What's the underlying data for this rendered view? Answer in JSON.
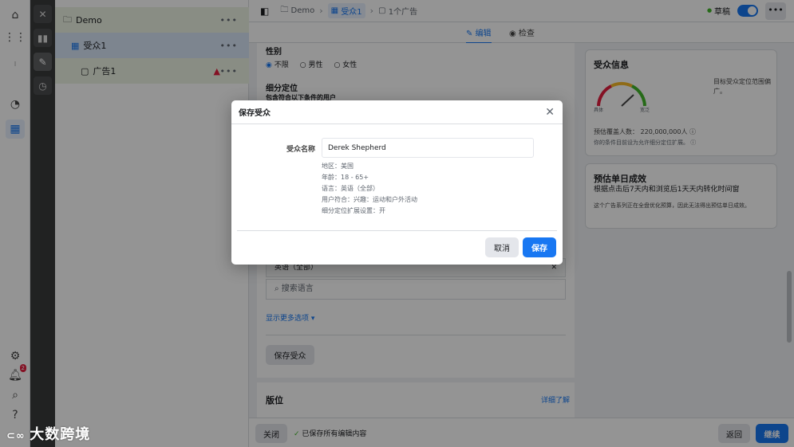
{
  "tree": {
    "campaign": "Demo",
    "adset": "受众1",
    "ad": "广告1"
  },
  "topbar": {
    "crumbs": [
      "Demo",
      "受众1",
      "1个广告"
    ],
    "draft_label": "草稿"
  },
  "tabs": {
    "edit": "编辑",
    "review": "检查"
  },
  "form": {
    "gender_label": "性别",
    "gender_options": [
      "不限",
      "男性",
      "女性"
    ],
    "detailed_targeting_label": "细分定位",
    "detailed_targeting_hint": "包含符合以下条件的用户",
    "language_value": "英语（全部）",
    "language_search_placeholder": "搜索语言",
    "show_more": "显示更多选项",
    "save_audience": "保存受众",
    "placements_label": "版位",
    "learn_more": "详细了解"
  },
  "audience_info": {
    "title": "受众信息",
    "gauge_left": "具体",
    "gauge_right": "宽泛",
    "gauge_desc": "目标受众定位范围偏广。",
    "estimated_reach_label": "预估覆盖人数：",
    "estimated_reach_value": "220,000,000人",
    "expansion_note": "你的条件目前设为允许细分定位扩展。"
  },
  "daily_results": {
    "title": "预估单日成效",
    "subtitle": "根据点击后7天内和浏览后1天天内转化时间窗",
    "note": "这个广告系列正在全盘优化预算，因此无法得出预估单日成效。"
  },
  "bottom_bar": {
    "close": "关闭",
    "saved_status": "已保存所有编辑内容",
    "back": "返回",
    "continue": "继续"
  },
  "modal": {
    "title": "保存受众",
    "name_label": "受众名称",
    "name_value": "Derek Shepherd",
    "details": [
      "地区：美国",
      "年龄：18 - 65+",
      "语言：英语（全部）",
      "用户符合：兴趣：运动和户外活动",
      "细分定位扩展设置：开"
    ],
    "cancel": "取消",
    "save": "保存"
  },
  "notifications_count": "2",
  "watermark": "大数跨境",
  "colors": {
    "accent": "#1877f2",
    "warning": "#e41e3f",
    "tree_bg": "#3a3b3c"
  }
}
